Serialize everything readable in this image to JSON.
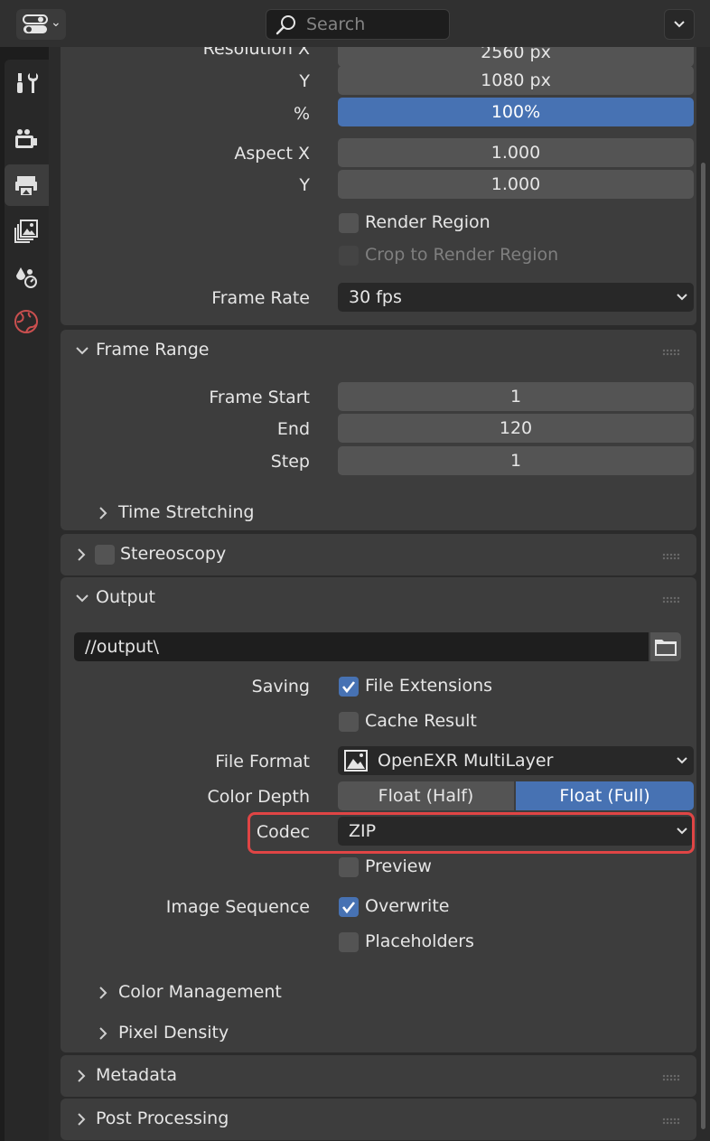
{
  "header": {
    "editor_icon": "properties-editor-icon",
    "search_placeholder": "Search",
    "options_icon": "chevron-down-icon"
  },
  "tabs": [
    {
      "name": "tool",
      "icon": "wrench-screwdriver-icon"
    },
    {
      "name": "render",
      "icon": "render-camera-icon"
    },
    {
      "name": "output",
      "icon": "printer-icon",
      "active": true
    },
    {
      "name": "view-layer",
      "icon": "image-stack-icon"
    },
    {
      "name": "scene",
      "icon": "scene-icon"
    },
    {
      "name": "world",
      "icon": "world-globe-icon"
    }
  ],
  "format": {
    "resolution_x_label": "Resolution X",
    "resolution_x_value": "2560 px",
    "resolution_y_label": "Y",
    "resolution_y_value": "1080 px",
    "percent_label": "%",
    "percent_value": "100%",
    "aspect_x_label": "Aspect X",
    "aspect_x_value": "1.000",
    "aspect_y_label": "Y",
    "aspect_y_value": "1.000",
    "render_region": "Render Region",
    "crop_region": "Crop to Render Region",
    "frame_rate_label": "Frame Rate",
    "frame_rate_value": "30 fps"
  },
  "frame_range": {
    "title": "Frame Range",
    "start_label": "Frame Start",
    "start_value": "1",
    "end_label": "End",
    "end_value": "120",
    "step_label": "Step",
    "step_value": "1",
    "time_stretching": "Time Stretching"
  },
  "stereoscopy": {
    "title": "Stereoscopy"
  },
  "output": {
    "title": "Output",
    "path": "//output\\",
    "saving_label": "Saving",
    "file_extensions": "File Extensions",
    "cache_result": "Cache Result",
    "file_format_label": "File Format",
    "file_format_value": "OpenEXR MultiLayer",
    "color_depth_label": "Color Depth",
    "depth_half": "Float (Half)",
    "depth_full": "Float (Full)",
    "codec_label": "Codec",
    "codec_value": "ZIP",
    "preview": "Preview",
    "image_sequence_label": "Image Sequence",
    "overwrite": "Overwrite",
    "placeholders": "Placeholders",
    "color_management": "Color Management",
    "pixel_density": "Pixel Density"
  },
  "metadata": {
    "title": "Metadata"
  },
  "post_processing": {
    "title": "Post Processing"
  },
  "colors": {
    "accent": "#4772b3",
    "highlight": "#e04545"
  }
}
